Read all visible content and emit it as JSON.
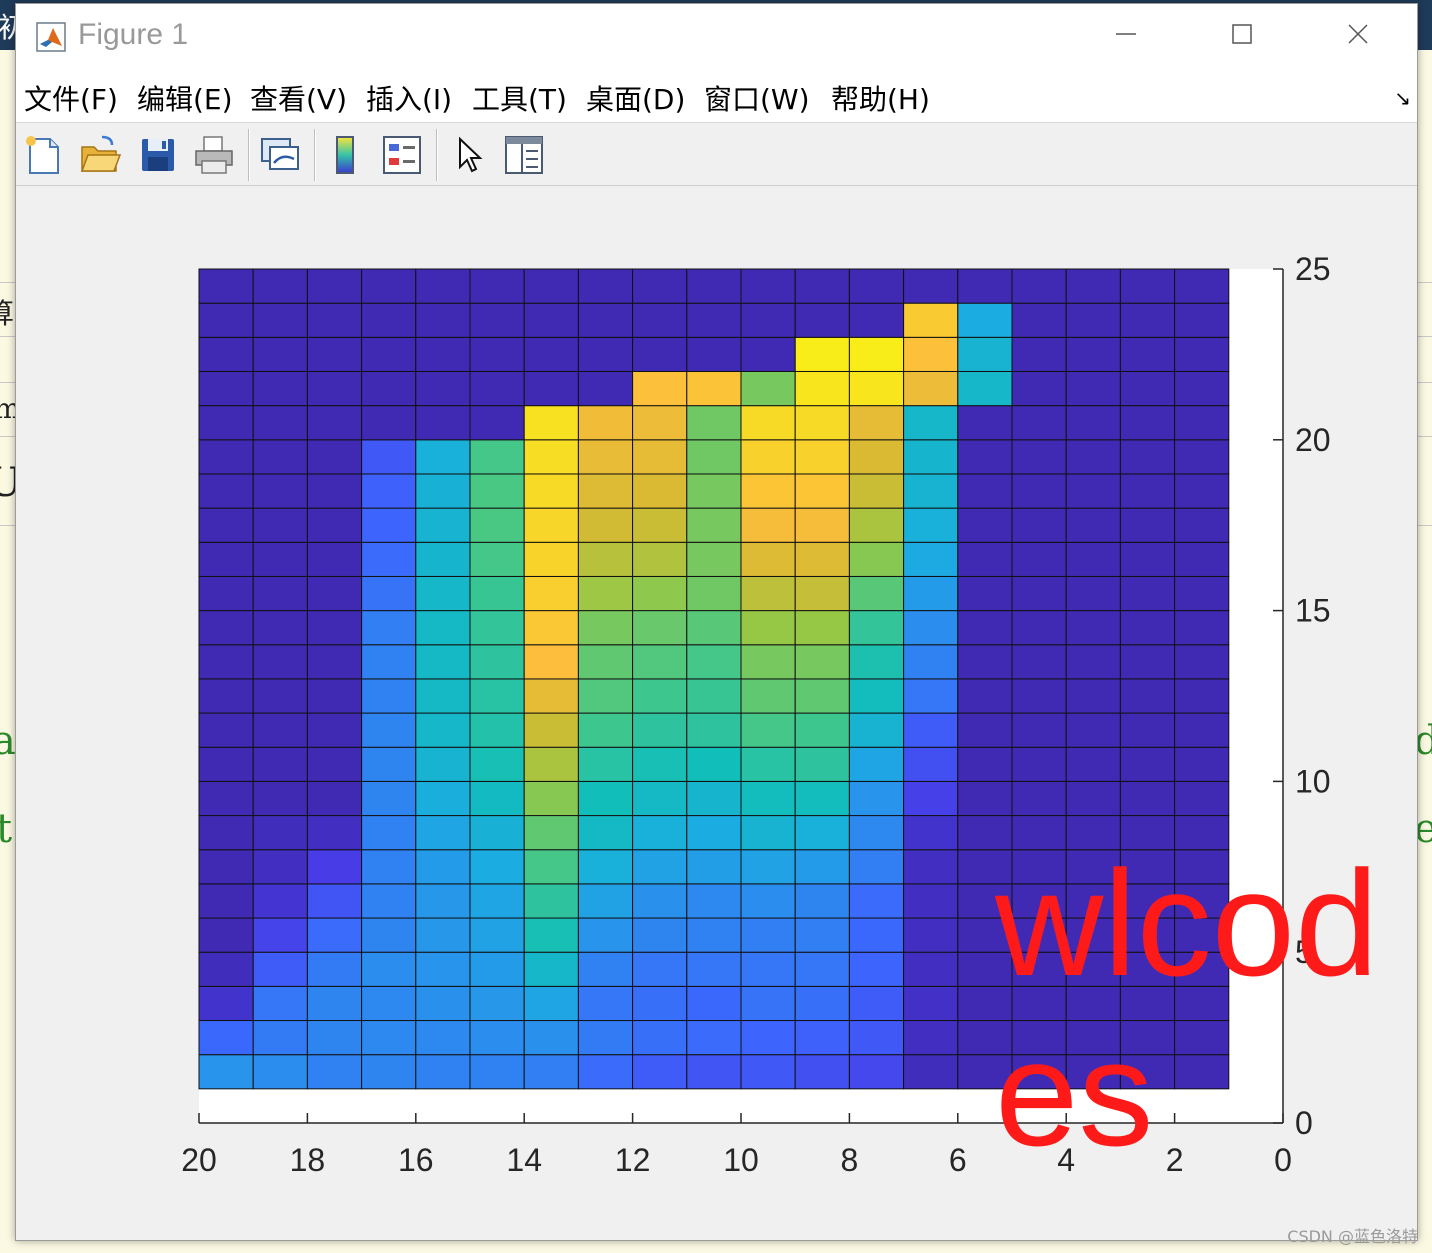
{
  "window": {
    "title": "Figure 1",
    "buttons": [
      "minimize",
      "maximize",
      "close"
    ]
  },
  "menu": [
    "文件(F)",
    "编辑(E)",
    "查看(V)",
    "插入(I)",
    "工具(T)",
    "桌面(D)",
    "窗口(W)",
    "帮助(H)"
  ],
  "toolbar": [
    {
      "name": "new-figure-icon"
    },
    {
      "name": "open-file-icon"
    },
    {
      "name": "save-icon"
    },
    {
      "name": "print-icon"
    },
    {
      "name": "link-plot-icon"
    },
    {
      "name": "colorbar-icon"
    },
    {
      "name": "legend-icon"
    },
    {
      "name": "edit-plot-pointer-icon"
    },
    {
      "name": "property-inspector-icon"
    }
  ],
  "background_text": {
    "left": [
      "初",
      "算法",
      "m",
      "U",
      "a",
      "t"
    ],
    "right": [
      "d",
      "e"
    ]
  },
  "watermark": "wlcodes",
  "credit": "CSDN @蓝色洛特",
  "chart_data": {
    "type": "heatmap",
    "title": "",
    "xlabel": "",
    "ylabel": "",
    "xlim": [
      20,
      0
    ],
    "x_reversed": true,
    "ylim": [
      0,
      25
    ],
    "y_axis_side": "right",
    "x_ticks": [
      20,
      18,
      16,
      14,
      12,
      10,
      8,
      6,
      4,
      2,
      0
    ],
    "y_ticks": [
      0,
      5,
      10,
      15,
      20,
      25
    ],
    "grid": false,
    "colormap": "parula",
    "cell_width": 1,
    "cell_height": 1,
    "x_edges_start": 20,
    "y_edges_start": 1,
    "columns": 19,
    "rows": 24,
    "values_note_rows_bottom_to_top": true,
    "values": [
      [
        0.33,
        0.31,
        0.28,
        0.29,
        0.28,
        0.28,
        0.27,
        0.22,
        0.18,
        0.16,
        0.17,
        0.15,
        0.13,
        0.03,
        0.02,
        0.02,
        0.02,
        0.02,
        0.02
      ],
      [
        0.21,
        0.26,
        0.29,
        0.3,
        0.3,
        0.31,
        0.32,
        0.26,
        0.23,
        0.22,
        0.2,
        0.19,
        0.17,
        0.04,
        0.02,
        0.02,
        0.02,
        0.02,
        0.02
      ],
      [
        0.06,
        0.25,
        0.29,
        0.3,
        0.32,
        0.34,
        0.38,
        0.25,
        0.23,
        0.21,
        0.24,
        0.23,
        0.18,
        0.05,
        0.02,
        0.02,
        0.02,
        0.02,
        0.02
      ],
      [
        0.03,
        0.18,
        0.26,
        0.31,
        0.33,
        0.35,
        0.46,
        0.28,
        0.25,
        0.25,
        0.25,
        0.25,
        0.2,
        0.04,
        0.02,
        0.02,
        0.02,
        0.02,
        0.02
      ],
      [
        0.02,
        0.12,
        0.22,
        0.29,
        0.34,
        0.37,
        0.51,
        0.33,
        0.29,
        0.28,
        0.27,
        0.27,
        0.21,
        0.04,
        0.02,
        0.02,
        0.02,
        0.02,
        0.02
      ],
      [
        0.02,
        0.07,
        0.16,
        0.28,
        0.34,
        0.38,
        0.55,
        0.37,
        0.32,
        0.3,
        0.31,
        0.29,
        0.22,
        0.04,
        0.02,
        0.02,
        0.02,
        0.02,
        0.02
      ],
      [
        0.02,
        0.04,
        0.1,
        0.28,
        0.35,
        0.4,
        0.59,
        0.42,
        0.37,
        0.36,
        0.37,
        0.35,
        0.27,
        0.04,
        0.02,
        0.02,
        0.02,
        0.02,
        0.02
      ],
      [
        0.02,
        0.03,
        0.04,
        0.28,
        0.38,
        0.43,
        0.63,
        0.47,
        0.42,
        0.4,
        0.44,
        0.42,
        0.3,
        0.06,
        0.02,
        0.02,
        0.02,
        0.02,
        0.02
      ],
      [
        0.02,
        0.02,
        0.02,
        0.29,
        0.41,
        0.48,
        0.68,
        0.5,
        0.47,
        0.45,
        0.49,
        0.49,
        0.33,
        0.11,
        0.02,
        0.02,
        0.02,
        0.02,
        0.02
      ],
      [
        0.02,
        0.02,
        0.02,
        0.29,
        0.44,
        0.51,
        0.73,
        0.54,
        0.51,
        0.5,
        0.54,
        0.55,
        0.38,
        0.15,
        0.02,
        0.02,
        0.02,
        0.02,
        0.02
      ],
      [
        0.02,
        0.02,
        0.02,
        0.29,
        0.46,
        0.53,
        0.78,
        0.58,
        0.55,
        0.55,
        0.59,
        0.58,
        0.44,
        0.18,
        0.02,
        0.02,
        0.02,
        0.02,
        0.02
      ],
      [
        0.02,
        0.02,
        0.02,
        0.28,
        0.47,
        0.54,
        0.84,
        0.61,
        0.58,
        0.57,
        0.63,
        0.63,
        0.49,
        0.25,
        0.02,
        0.02,
        0.02,
        0.02,
        0.02
      ],
      [
        0.02,
        0.02,
        0.02,
        0.28,
        0.47,
        0.55,
        0.9,
        0.63,
        0.61,
        0.59,
        0.66,
        0.66,
        0.52,
        0.28,
        0.02,
        0.02,
        0.02,
        0.02,
        0.02
      ],
      [
        0.02,
        0.02,
        0.02,
        0.27,
        0.47,
        0.56,
        0.94,
        0.66,
        0.64,
        0.62,
        0.7,
        0.7,
        0.56,
        0.31,
        0.02,
        0.02,
        0.02,
        0.02,
        0.02
      ],
      [
        0.02,
        0.02,
        0.02,
        0.24,
        0.46,
        0.57,
        0.97,
        0.71,
        0.69,
        0.65,
        0.76,
        0.77,
        0.62,
        0.35,
        0.02,
        0.02,
        0.02,
        0.02,
        0.02
      ],
      [
        0.02,
        0.02,
        0.02,
        0.22,
        0.45,
        0.59,
        0.99,
        0.75,
        0.74,
        0.66,
        0.82,
        0.82,
        0.68,
        0.39,
        0.02,
        0.02,
        0.02,
        0.02,
        0.02
      ],
      [
        0.02,
        0.02,
        0.02,
        0.2,
        0.44,
        0.6,
        1.0,
        0.79,
        0.78,
        0.66,
        0.88,
        0.88,
        0.73,
        0.42,
        0.02,
        0.02,
        0.02,
        0.02,
        0.02
      ],
      [
        0.02,
        0.02,
        0.02,
        0.19,
        0.43,
        0.6,
        1.01,
        0.82,
        0.81,
        0.66,
        0.93,
        0.93,
        0.78,
        0.44,
        0.02,
        0.02,
        0.02,
        0.02,
        0.02
      ],
      [
        0.02,
        0.02,
        0.02,
        0.17,
        0.42,
        0.59,
        1.02,
        0.85,
        0.84,
        0.65,
        0.98,
        0.98,
        0.81,
        0.45,
        0.02,
        0.02,
        0.02,
        0.02,
        0.02
      ],
      [
        0.02,
        0.02,
        0.02,
        0.02,
        0.02,
        0.02,
        1.03,
        0.87,
        0.86,
        0.65,
        1.01,
        1.01,
        0.84,
        0.46,
        0.02,
        0.02,
        0.02,
        0.02,
        0.02
      ],
      [
        0.02,
        0.02,
        0.02,
        0.02,
        0.02,
        0.02,
        0.02,
        0.02,
        0.91,
        0.92,
        0.66,
        1.04,
        1.04,
        0.86,
        0.46,
        0.02,
        0.02,
        0.02,
        0.02
      ],
      [
        0.02,
        0.02,
        0.02,
        0.02,
        0.02,
        0.02,
        0.02,
        0.02,
        0.02,
        0.02,
        0.02,
        1.06,
        1.06,
        0.91,
        0.44,
        0.02,
        0.02,
        0.02,
        0.02
      ],
      [
        0.02,
        0.02,
        0.02,
        0.02,
        0.02,
        0.02,
        0.02,
        0.02,
        0.02,
        0.02,
        0.02,
        0.02,
        0.02,
        0.95,
        0.4,
        0.02,
        0.02,
        0.02,
        0.02
      ],
      [
        0.02,
        0.02,
        0.02,
        0.02,
        0.02,
        0.02,
        0.02,
        0.02,
        0.02,
        0.02,
        0.02,
        0.02,
        0.02,
        0.02,
        0.02,
        0.02,
        0.02,
        0.02,
        0.02
      ]
    ],
    "color_range": [
      0,
      1.1
    ]
  }
}
